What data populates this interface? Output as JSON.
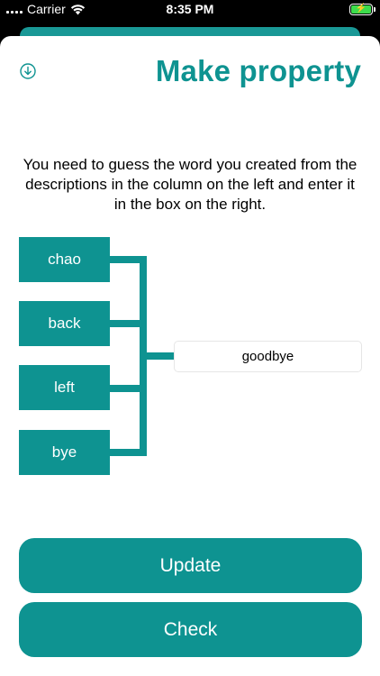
{
  "status_bar": {
    "carrier": "Carrier",
    "time": "8:35 PM",
    "icons": [
      "signal-icon",
      "wifi-icon",
      "battery-charging-icon"
    ],
    "battery_color": "#3ddc4c"
  },
  "header": {
    "download_icon": "download-circle-icon",
    "title": "Make property"
  },
  "instructions": "You need to guess the word you created from the descriptions in the column on the left and enter it in the box on the right.",
  "words": [
    "chao",
    "back",
    "left",
    "bye"
  ],
  "answer": {
    "value": "goodbye",
    "placeholder": ""
  },
  "buttons": {
    "update": "Update",
    "check": "Check"
  },
  "colors": {
    "accent": "#0e9391",
    "background": "#ffffff"
  }
}
